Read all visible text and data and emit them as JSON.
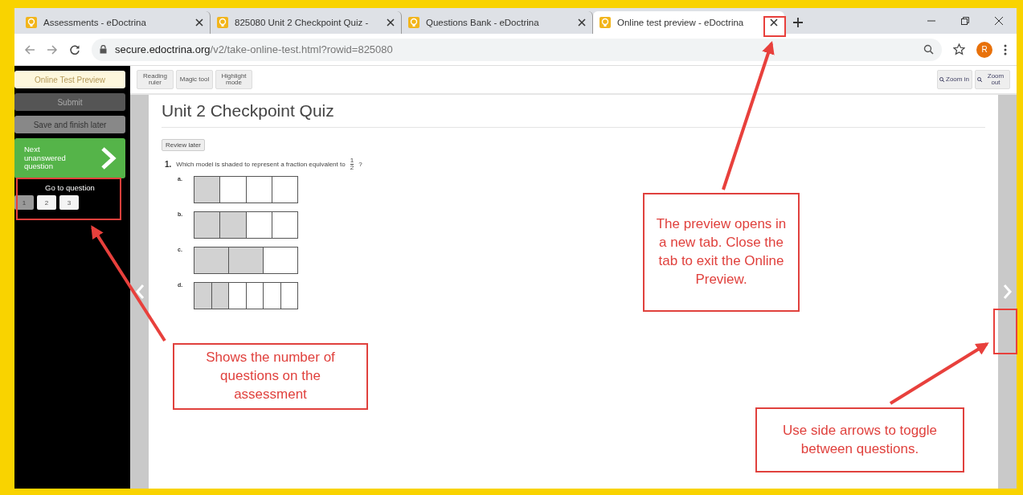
{
  "tabs": [
    {
      "title": "Assessments - eDoctrina",
      "selected": false
    },
    {
      "title": "825080 Unit 2 Checkpoint Quiz -",
      "selected": false
    },
    {
      "title": "Questions Bank - eDoctrina",
      "selected": false
    },
    {
      "title": "Online test preview - eDoctrina",
      "selected": true
    }
  ],
  "address_bar": {
    "url_host": "secure.edoctrina.org",
    "url_path": "/v2/take-online-test.html?rowid=825080",
    "avatar": "R"
  },
  "sidebar": {
    "preview_label": "Online Test Preview",
    "submit": "Submit",
    "save": "Save and finish later",
    "next": "Next unanswered question",
    "goto_label": "Go to question",
    "questions": [
      {
        "label": "1",
        "selected": true
      },
      {
        "label": "2",
        "selected": false
      },
      {
        "label": "3",
        "selected": false
      }
    ]
  },
  "toolbar": {
    "tools": [
      "Reading ruler",
      "Magic tool",
      "Highlight mode"
    ],
    "zoom": [
      "Zoom in",
      "Zoom out"
    ]
  },
  "quiz": {
    "title": "Unit 2 Checkpoint Quiz",
    "review_button": "Review later",
    "number": "1.",
    "question": "Which model is shaded to represent a fraction equivalent to",
    "numerator": "1",
    "denominator": "2",
    "question_end": "?",
    "options": [
      {
        "label": "a.",
        "cells": [
          {
            "shaded": true
          },
          {
            "shaded": false
          },
          {
            "shaded": false
          },
          {
            "shaded": false
          }
        ]
      },
      {
        "label": "b.",
        "cells": [
          {
            "shaded": true
          },
          {
            "shaded": true
          },
          {
            "shaded": false
          },
          {
            "shaded": false
          }
        ]
      },
      {
        "label": "c.",
        "cells": [
          {
            "shaded": true
          },
          {
            "shaded": true
          },
          {
            "shaded": false
          }
        ]
      },
      {
        "label": "d.",
        "cells": [
          {
            "shaded": true
          },
          {
            "shaded": true
          },
          {
            "shaded": false
          },
          {
            "shaded": false
          },
          {
            "shaded": false
          },
          {
            "shaded": false
          }
        ]
      }
    ]
  },
  "callouts": [
    {
      "kind": "tab",
      "text": "The preview opens in a new tab. Close the tab to exit the Online Preview."
    },
    {
      "kind": "questions",
      "text": "Shows the number of questions on the assessment"
    },
    {
      "kind": "arrows",
      "text": "Use side arrows to toggle between questions."
    }
  ]
}
